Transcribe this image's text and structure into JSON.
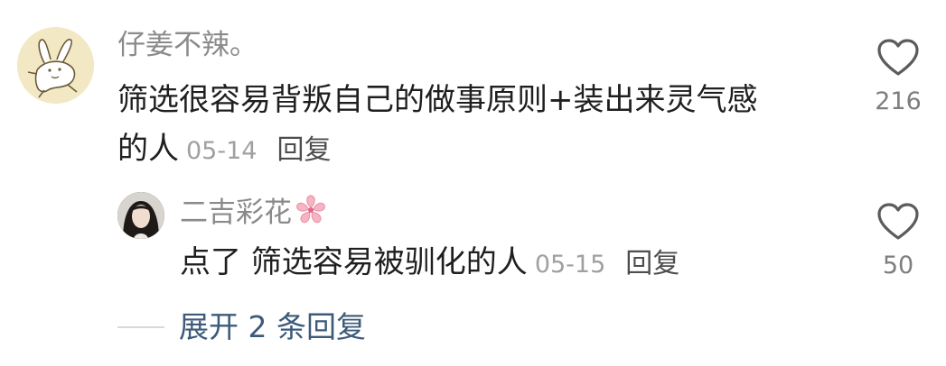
{
  "comment": {
    "username": "仔姜不辣。",
    "text_line1": "筛选很容易背叛自己的做事原则+装出来灵气感",
    "text_line2": "的人",
    "date": "05-14",
    "reply_label": "回复",
    "like_count": "216",
    "like_icon": "heart-outline-icon",
    "avatar": "rabbit-drawing-avatar"
  },
  "reply": {
    "username": "二吉彩花",
    "username_badge_icon": "cherry-blossom-icon",
    "text": "点了 筛选容易被驯化的人",
    "date": "05-15",
    "reply_label": "回复",
    "like_count": "50",
    "like_icon": "heart-outline-icon",
    "avatar": "portrait-photo-avatar"
  },
  "expand": {
    "label": "展开 2 条回复"
  },
  "colors": {
    "username": "#8a8a8a",
    "text": "#1f1f1f",
    "date": "#a0a0a0",
    "expand_link": "#3d5a7a"
  }
}
